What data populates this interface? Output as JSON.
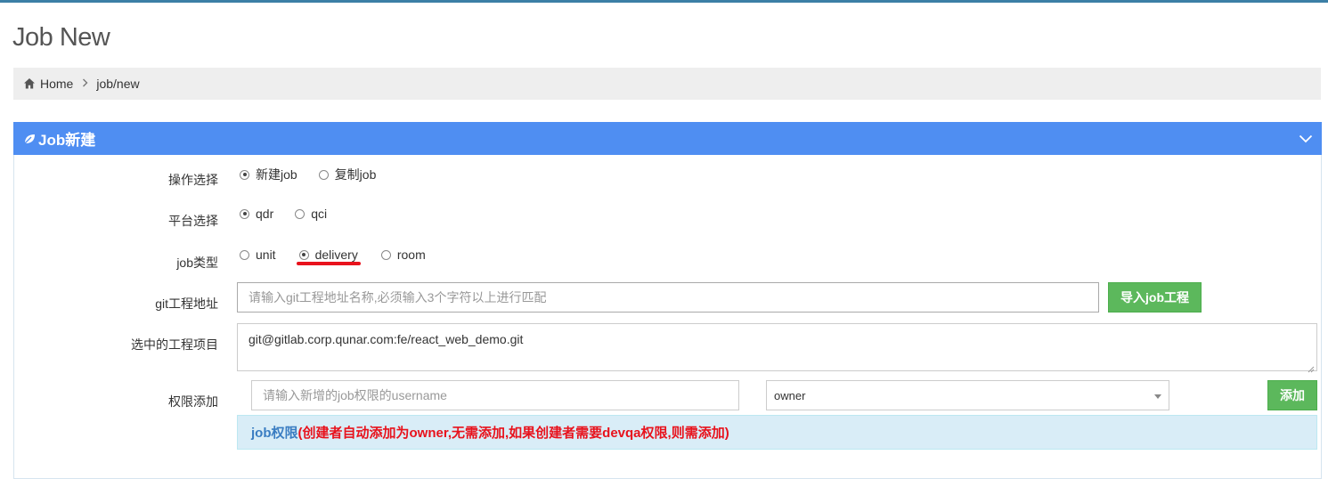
{
  "page": {
    "title": "Job New"
  },
  "breadcrumb": {
    "home": "Home",
    "current": "job/new"
  },
  "panel": {
    "title": "Job新建"
  },
  "form": {
    "operation": {
      "label": "操作选择",
      "options": [
        {
          "label": "新建job",
          "selected": true
        },
        {
          "label": "复制job",
          "selected": false
        }
      ]
    },
    "platform": {
      "label": "平台选择",
      "options": [
        {
          "label": "qdr",
          "selected": true
        },
        {
          "label": "qci",
          "selected": false
        }
      ]
    },
    "job_type": {
      "label": "job类型",
      "options": [
        {
          "label": "unit",
          "selected": false
        },
        {
          "label": "delivery",
          "selected": true
        },
        {
          "label": "room",
          "selected": false
        }
      ]
    },
    "git_address": {
      "label": "git工程地址",
      "placeholder": "请输入git工程地址名称,必须输入3个字符以上进行匹配",
      "button": "导入job工程"
    },
    "selected_project": {
      "label": "选中的工程项目",
      "value": "git@gitlab.corp.qunar.com:fe/react_web_demo.git"
    },
    "permission": {
      "label": "权限添加",
      "placeholder": "请输入新增的job权限的username",
      "role_value": "owner",
      "button": "添加"
    },
    "info": {
      "prefix": "job权限",
      "text": "(创建者自动添加为owner,无需添加,如果创建者需要devqa权限,则需添加)"
    }
  },
  "colors": {
    "panel_header": "#4f8ef2",
    "button_green": "#5cb85c",
    "info_bg": "#d9edf7",
    "warning_red": "#e8121c",
    "annotation_underline": "#e8121c"
  },
  "icons": {
    "breadcrumb_home": "home-icon",
    "panel_header": "leaf-icon",
    "panel_collapse": "chevron-down-icon",
    "select_caret": "caret-down-icon"
  }
}
